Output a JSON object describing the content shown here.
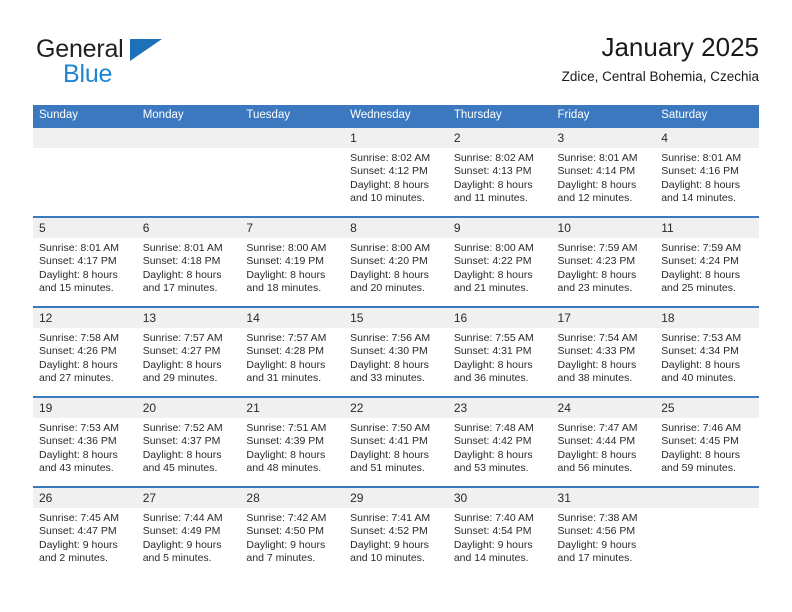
{
  "brand": {
    "name_top": "General",
    "name_bottom": "Blue",
    "triangle_color": "#1d71b8",
    "blue_text_color": "#1d86d0"
  },
  "header": {
    "title": "January 2025",
    "subtitle": "Zdice, Central Bohemia, Czechia"
  },
  "theme": {
    "header_row_bg": "#3b78c0",
    "daynum_bg": "#f0f0f0",
    "cell_bg": "#ffffff",
    "text_color": "#2a2a2a"
  },
  "weekdays": [
    "Sunday",
    "Monday",
    "Tuesday",
    "Wednesday",
    "Thursday",
    "Friday",
    "Saturday"
  ],
  "labels": {
    "sunrise_prefix": "Sunrise: ",
    "sunset_prefix": "Sunset: ",
    "daylight_prefix": "Daylight: "
  },
  "weeks": [
    [
      {
        "day": "",
        "lines": []
      },
      {
        "day": "",
        "lines": []
      },
      {
        "day": "",
        "lines": []
      },
      {
        "day": "1",
        "lines": [
          "Sunrise: 8:02 AM",
          "Sunset: 4:12 PM",
          "Daylight: 8 hours",
          "and 10 minutes."
        ]
      },
      {
        "day": "2",
        "lines": [
          "Sunrise: 8:02 AM",
          "Sunset: 4:13 PM",
          "Daylight: 8 hours",
          "and 11 minutes."
        ]
      },
      {
        "day": "3",
        "lines": [
          "Sunrise: 8:01 AM",
          "Sunset: 4:14 PM",
          "Daylight: 8 hours",
          "and 12 minutes."
        ]
      },
      {
        "day": "4",
        "lines": [
          "Sunrise: 8:01 AM",
          "Sunset: 4:16 PM",
          "Daylight: 8 hours",
          "and 14 minutes."
        ]
      }
    ],
    [
      {
        "day": "5",
        "lines": [
          "Sunrise: 8:01 AM",
          "Sunset: 4:17 PM",
          "Daylight: 8 hours",
          "and 15 minutes."
        ]
      },
      {
        "day": "6",
        "lines": [
          "Sunrise: 8:01 AM",
          "Sunset: 4:18 PM",
          "Daylight: 8 hours",
          "and 17 minutes."
        ]
      },
      {
        "day": "7",
        "lines": [
          "Sunrise: 8:00 AM",
          "Sunset: 4:19 PM",
          "Daylight: 8 hours",
          "and 18 minutes."
        ]
      },
      {
        "day": "8",
        "lines": [
          "Sunrise: 8:00 AM",
          "Sunset: 4:20 PM",
          "Daylight: 8 hours",
          "and 20 minutes."
        ]
      },
      {
        "day": "9",
        "lines": [
          "Sunrise: 8:00 AM",
          "Sunset: 4:22 PM",
          "Daylight: 8 hours",
          "and 21 minutes."
        ]
      },
      {
        "day": "10",
        "lines": [
          "Sunrise: 7:59 AM",
          "Sunset: 4:23 PM",
          "Daylight: 8 hours",
          "and 23 minutes."
        ]
      },
      {
        "day": "11",
        "lines": [
          "Sunrise: 7:59 AM",
          "Sunset: 4:24 PM",
          "Daylight: 8 hours",
          "and 25 minutes."
        ]
      }
    ],
    [
      {
        "day": "12",
        "lines": [
          "Sunrise: 7:58 AM",
          "Sunset: 4:26 PM",
          "Daylight: 8 hours",
          "and 27 minutes."
        ]
      },
      {
        "day": "13",
        "lines": [
          "Sunrise: 7:57 AM",
          "Sunset: 4:27 PM",
          "Daylight: 8 hours",
          "and 29 minutes."
        ]
      },
      {
        "day": "14",
        "lines": [
          "Sunrise: 7:57 AM",
          "Sunset: 4:28 PM",
          "Daylight: 8 hours",
          "and 31 minutes."
        ]
      },
      {
        "day": "15",
        "lines": [
          "Sunrise: 7:56 AM",
          "Sunset: 4:30 PM",
          "Daylight: 8 hours",
          "and 33 minutes."
        ]
      },
      {
        "day": "16",
        "lines": [
          "Sunrise: 7:55 AM",
          "Sunset: 4:31 PM",
          "Daylight: 8 hours",
          "and 36 minutes."
        ]
      },
      {
        "day": "17",
        "lines": [
          "Sunrise: 7:54 AM",
          "Sunset: 4:33 PM",
          "Daylight: 8 hours",
          "and 38 minutes."
        ]
      },
      {
        "day": "18",
        "lines": [
          "Sunrise: 7:53 AM",
          "Sunset: 4:34 PM",
          "Daylight: 8 hours",
          "and 40 minutes."
        ]
      }
    ],
    [
      {
        "day": "19",
        "lines": [
          "Sunrise: 7:53 AM",
          "Sunset: 4:36 PM",
          "Daylight: 8 hours",
          "and 43 minutes."
        ]
      },
      {
        "day": "20",
        "lines": [
          "Sunrise: 7:52 AM",
          "Sunset: 4:37 PM",
          "Daylight: 8 hours",
          "and 45 minutes."
        ]
      },
      {
        "day": "21",
        "lines": [
          "Sunrise: 7:51 AM",
          "Sunset: 4:39 PM",
          "Daylight: 8 hours",
          "and 48 minutes."
        ]
      },
      {
        "day": "22",
        "lines": [
          "Sunrise: 7:50 AM",
          "Sunset: 4:41 PM",
          "Daylight: 8 hours",
          "and 51 minutes."
        ]
      },
      {
        "day": "23",
        "lines": [
          "Sunrise: 7:48 AM",
          "Sunset: 4:42 PM",
          "Daylight: 8 hours",
          "and 53 minutes."
        ]
      },
      {
        "day": "24",
        "lines": [
          "Sunrise: 7:47 AM",
          "Sunset: 4:44 PM",
          "Daylight: 8 hours",
          "and 56 minutes."
        ]
      },
      {
        "day": "25",
        "lines": [
          "Sunrise: 7:46 AM",
          "Sunset: 4:45 PM",
          "Daylight: 8 hours",
          "and 59 minutes."
        ]
      }
    ],
    [
      {
        "day": "26",
        "lines": [
          "Sunrise: 7:45 AM",
          "Sunset: 4:47 PM",
          "Daylight: 9 hours",
          "and 2 minutes."
        ]
      },
      {
        "day": "27",
        "lines": [
          "Sunrise: 7:44 AM",
          "Sunset: 4:49 PM",
          "Daylight: 9 hours",
          "and 5 minutes."
        ]
      },
      {
        "day": "28",
        "lines": [
          "Sunrise: 7:42 AM",
          "Sunset: 4:50 PM",
          "Daylight: 9 hours",
          "and 7 minutes."
        ]
      },
      {
        "day": "29",
        "lines": [
          "Sunrise: 7:41 AM",
          "Sunset: 4:52 PM",
          "Daylight: 9 hours",
          "and 10 minutes."
        ]
      },
      {
        "day": "30",
        "lines": [
          "Sunrise: 7:40 AM",
          "Sunset: 4:54 PM",
          "Daylight: 9 hours",
          "and 14 minutes."
        ]
      },
      {
        "day": "31",
        "lines": [
          "Sunrise: 7:38 AM",
          "Sunset: 4:56 PM",
          "Daylight: 9 hours",
          "and 17 minutes."
        ]
      },
      {
        "day": "",
        "lines": []
      }
    ]
  ]
}
